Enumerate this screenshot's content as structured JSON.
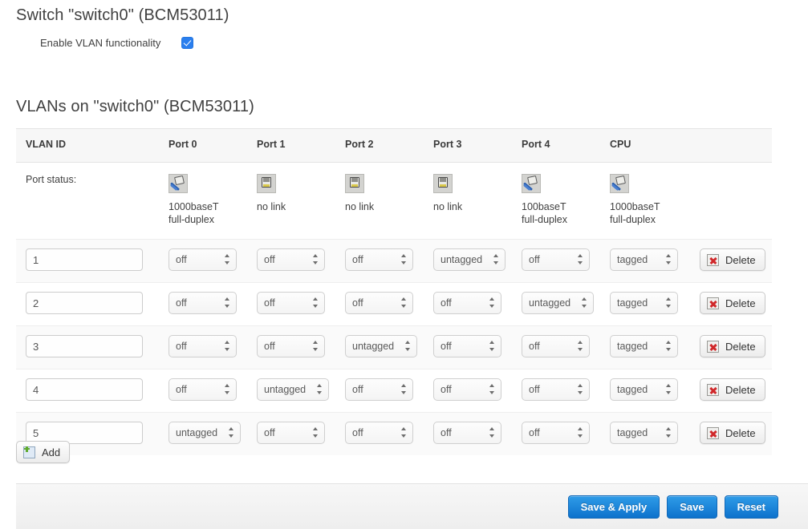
{
  "switch_section": {
    "title": "Switch \"switch0\" (BCM53011)",
    "enable_vlan_label": "Enable VLAN functionality",
    "enable_vlan_checked": true
  },
  "vlan_section": {
    "title": "VLANs on \"switch0\" (BCM53011)",
    "columns": [
      "VLAN ID",
      "Port 0",
      "Port 1",
      "Port 2",
      "Port 3",
      "Port 4",
      "CPU"
    ],
    "port_status_label": "Port status:",
    "port_status": [
      {
        "port": "Port 0",
        "icon": "ethernet-connected-icon",
        "link": true,
        "speed": "1000baseT",
        "duplex": "full-duplex"
      },
      {
        "port": "Port 1",
        "icon": "ethernet-nolink-icon",
        "link": false,
        "speed": "no link",
        "duplex": ""
      },
      {
        "port": "Port 2",
        "icon": "ethernet-nolink-icon",
        "link": false,
        "speed": "no link",
        "duplex": ""
      },
      {
        "port": "Port 3",
        "icon": "ethernet-nolink-icon",
        "link": false,
        "speed": "no link",
        "duplex": ""
      },
      {
        "port": "Port 4",
        "icon": "ethernet-connected-icon",
        "link": true,
        "speed": "100baseT",
        "duplex": "full-duplex"
      },
      {
        "port": "CPU",
        "icon": "ethernet-connected-icon",
        "link": true,
        "speed": "1000baseT",
        "duplex": "full-duplex"
      }
    ],
    "rows": [
      {
        "vlan_id": "1",
        "ports": [
          "off",
          "off",
          "off",
          "untagged",
          "off",
          "tagged"
        ],
        "delete_label": "Delete"
      },
      {
        "vlan_id": "2",
        "ports": [
          "off",
          "off",
          "off",
          "off",
          "untagged",
          "tagged"
        ],
        "delete_label": "Delete"
      },
      {
        "vlan_id": "3",
        "ports": [
          "off",
          "off",
          "untagged",
          "off",
          "off",
          "tagged"
        ],
        "delete_label": "Delete"
      },
      {
        "vlan_id": "4",
        "ports": [
          "off",
          "untagged",
          "off",
          "off",
          "off",
          "tagged"
        ],
        "delete_label": "Delete"
      },
      {
        "vlan_id": "5",
        "ports": [
          "untagged",
          "off",
          "off",
          "off",
          "off",
          "tagged"
        ],
        "delete_label": "Delete"
      }
    ],
    "add_label": "Add"
  },
  "footer": {
    "save_apply_label": "Save & Apply",
    "save_label": "Save",
    "reset_label": "Reset"
  },
  "colors": {
    "accent_blue": "#1f8ddc",
    "checkbox_blue": "#2b7fee",
    "delete_red": "#d0282a",
    "add_green": "#5faa2e",
    "header_bg": "#f7f7f7",
    "odd_row_bg": "#fafafa"
  }
}
